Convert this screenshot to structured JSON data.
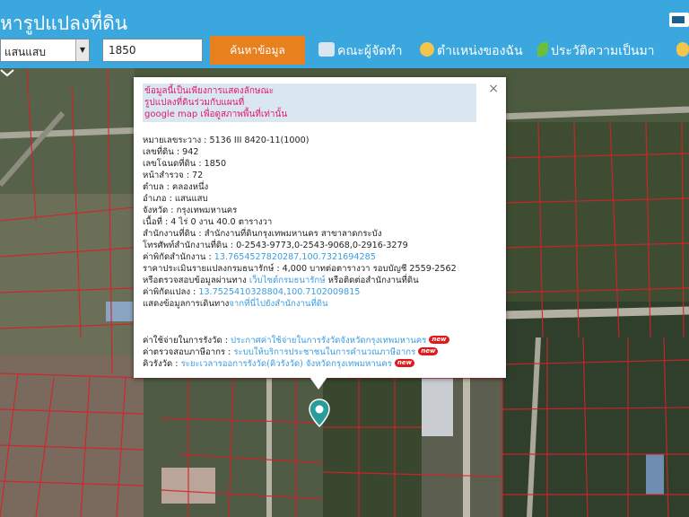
{
  "header": {
    "title": "หารูปแปลงที่ดิน",
    "district_select": "แสนแสบ",
    "deed_input": "1850",
    "search_label": "ค้นหาข้อมูล",
    "nav": [
      {
        "label": "คณะผู้จัดทำ",
        "icon": "book-icon"
      },
      {
        "label": "ตำแหน่งของฉัน",
        "icon": "smiley-icon"
      },
      {
        "label": "ประวัติความเป็นมา",
        "icon": "leaf-icon"
      }
    ]
  },
  "popup": {
    "close": "×",
    "notice": [
      "ข้อมูลนี้เป็นเพียงการแสดงลักษณะ",
      "รูปแปลงที่ดินร่วมกับแผนที่",
      "google map เพื่อดูสภาพพื้นที่เท่านั้น"
    ],
    "fields": [
      {
        "label": "หมายเลขระวาง : ",
        "value": "5136 III 8420-11(1000)"
      },
      {
        "label": "เลขที่ดิน : ",
        "value": "942"
      },
      {
        "label": "เลขโฉนดที่ดิน : ",
        "value": "1850"
      },
      {
        "label": "หน้าสำรวจ : ",
        "value": "72"
      },
      {
        "label": "ตำบล : ",
        "value": "คลองหนึ่ง"
      },
      {
        "label": "อำเภอ : ",
        "value": "แสนแสบ"
      },
      {
        "label": "จังหวัด : ",
        "value": "กรุงเทพมหานคร"
      },
      {
        "label": "เนื้อที่ : ",
        "value": "4 ไร่ 0 งาน 40.0 ตารางวา"
      },
      {
        "label": "สำนักงานที่ดิน : ",
        "value": "สำนักงานที่ดินกรุงเทพมหานคร สาขาลาดกระบัง"
      },
      {
        "label": "โทรศัพท์สำนักงานที่ดิน : ",
        "value": "0-2543-9773,0-2543-9068,0-2916-3279"
      }
    ],
    "office_coord_label": "ค่าพิกัดสำนักงาน : ",
    "office_coord": "13.7654527820287,100.7321694285",
    "price_label": "ราคาประเมินรายแปลงกรมธนารักษ์ : ",
    "price_value": "4,000 บาทต่อตารางวา รอบบัญชี 2559-2562",
    "check_prefix": "หรือตรวจสอบข้อมูลผ่านทาง ",
    "check_link": "เว็บไซต์กรมธนารักษ์",
    "check_suffix": " หรือติดต่อสำนักงานที่ดิน",
    "parcel_coord_label": "ค่าพิกัดแปลง : ",
    "parcel_coord": "13.7525410328804,100.7102009815",
    "route_prefix": "แสดงข้อมูลการเดินทาง",
    "route_link": "จากที่นี่ไปยังสำนักงานที่ดิน",
    "links": [
      {
        "label": "ค่าใช้จ่ายในการรังวัด : ",
        "link": "ประกาศค่าใช้จ่ายในการรังวัดจังหวัดกรุงเทพมหานคร"
      },
      {
        "label": "ค่าตรวจสอบภาษีอากร : ",
        "link": "ระบบให้บริการประชาชนในการคำนวณภาษีอากร"
      },
      {
        "label": "คิวรังวัด : ",
        "link": "ระยะเวลารออการรังวัด(คิวรังวัด) จังหวัดกรุงเทพมหานคร"
      }
    ],
    "new_badge": "new"
  },
  "colors": {
    "header": "#3aa8df",
    "search_button": "#e8801e",
    "notice_text": "#e0186f",
    "link": "#3b9de0",
    "parcel_lines": "#d8202a"
  }
}
